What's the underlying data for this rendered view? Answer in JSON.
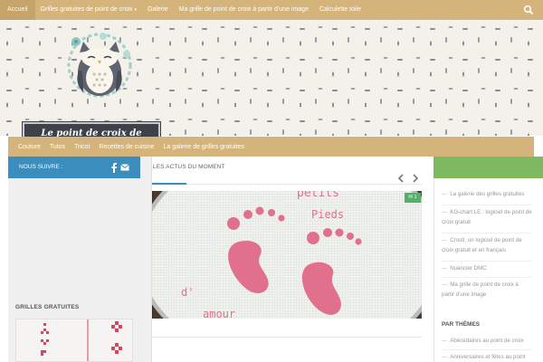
{
  "top_nav": {
    "items": [
      {
        "label": "Accueil"
      },
      {
        "label": "Grilles gratuites de point de croix",
        "caret": "▾"
      },
      {
        "label": "Galerie"
      },
      {
        "label": "Ma grille de point de croix à partir d'une image"
      },
      {
        "label": "Calculette toile"
      }
    ],
    "search_icon": "search-icon"
  },
  "header": {
    "logo_text": "Le point de croix de Martine"
  },
  "sub_nav": {
    "items": [
      "Couture",
      "Tutos",
      "Tricot",
      "Recettes de cuisine",
      "La galerie de grilles gratuites"
    ]
  },
  "left_sidebar": {
    "follow_label": "NOUS SUIVRE :",
    "grilles_title": "GRILLES GRATUITES"
  },
  "main": {
    "section_title": "LES ACTUS DU MOMENT",
    "comment_count": "1",
    "featured_text": {
      "line1": "petits",
      "line2": "Pieds",
      "line3": "d'",
      "line4": "amour"
    }
  },
  "right_sidebar": {
    "links": [
      "La galerie des grilles gratuites",
      "KG-chart LE : logiciel de point de croix gratuit",
      "Crosti, un logiciel de point de croix gratuit et en français",
      "Nuancier DMC",
      "Ma grille de point de croix à partir d'une image"
    ],
    "themes_title": "PAR THÈMES",
    "theme_links": [
      "Abécédaires au point de croix",
      "Anniversaires et fêtes au point"
    ]
  },
  "colors": {
    "nav": "#d5b47c",
    "follow": "#3b8dbd",
    "green": "#7eb85f",
    "stitch": "#e0708c"
  }
}
